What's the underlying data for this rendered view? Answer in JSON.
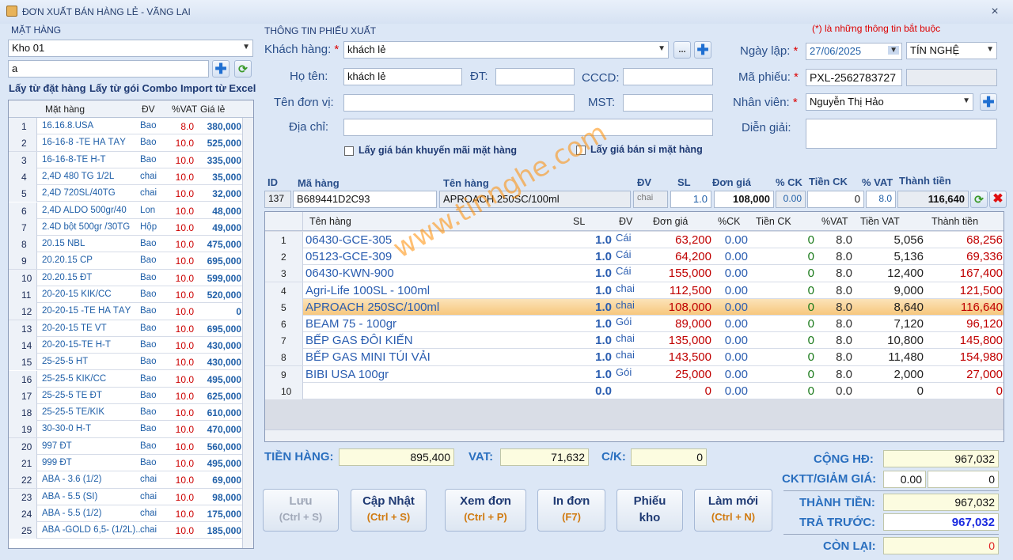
{
  "window": {
    "title": "ĐƠN XUẤT BÁN HÀNG LẺ - VÃNG LAI",
    "close": "×"
  },
  "left": {
    "section_title": "MẶT HÀNG",
    "warehouse": "Kho 01",
    "search_value": "a",
    "links": [
      "Lấy từ đặt hàng",
      "Lấy từ gói Combo",
      "Import từ Excel"
    ],
    "columns": [
      "Mặt hàng",
      "ĐV",
      "%VAT",
      "Giá lẻ"
    ],
    "rows": [
      {
        "no": "1",
        "name": "16.16.8.USA",
        "dv": "Bao",
        "vat": "8.0",
        "gia": "380,000"
      },
      {
        "no": "2",
        "name": "16-16-8 -TE HÀ TÂY",
        "dv": "Bao",
        "vat": "10.0",
        "gia": "525,000"
      },
      {
        "no": "3",
        "name": "16-16-8-TE H-T",
        "dv": "Bao",
        "vat": "10.0",
        "gia": "335,000"
      },
      {
        "no": "4",
        "name": "2,4D  480 TG 1/2L",
        "dv": "chai",
        "vat": "10.0",
        "gia": "35,000"
      },
      {
        "no": "5",
        "name": "2,4D 720SL/40TG",
        "dv": "chai",
        "vat": "10.0",
        "gia": "32,000"
      },
      {
        "no": "6",
        "name": "2,4D ALDO 500gr/40",
        "dv": "Lon",
        "vat": "10.0",
        "gia": "48,000"
      },
      {
        "no": "7",
        "name": "2.4D bột 500gr /30TG",
        "dv": "Hộp",
        "vat": "10.0",
        "gia": "49,000"
      },
      {
        "no": "8",
        "name": "20.15 NBL",
        "dv": "Bao",
        "vat": "10.0",
        "gia": "475,000"
      },
      {
        "no": "9",
        "name": "20.20.15 CP",
        "dv": "Bao",
        "vat": "10.0",
        "gia": "695,000"
      },
      {
        "no": "10",
        "name": "20.20.15 ĐT",
        "dv": "Bao",
        "vat": "10.0",
        "gia": "599,000"
      },
      {
        "no": "11",
        "name": "20-20-15 KIK/CC",
        "dv": "Bao",
        "vat": "10.0",
        "gia": "520,000"
      },
      {
        "no": "12",
        "name": "20-20-15 -TE HÀ TÂY",
        "dv": "Bao",
        "vat": "10.0",
        "gia": "0"
      },
      {
        "no": "13",
        "name": "20-20-15 TE VT",
        "dv": "Bao",
        "vat": "10.0",
        "gia": "695,000"
      },
      {
        "no": "14",
        "name": "20-20-15-TE H-T",
        "dv": "Bao",
        "vat": "10.0",
        "gia": "430,000"
      },
      {
        "no": "15",
        "name": "25-25-5 HT",
        "dv": "Bao",
        "vat": "10.0",
        "gia": "430,000"
      },
      {
        "no": "16",
        "name": "25-25-5 KIK/CC",
        "dv": "Bao",
        "vat": "10.0",
        "gia": "495,000"
      },
      {
        "no": "17",
        "name": "25-25-5 TE ĐT",
        "dv": "Bao",
        "vat": "10.0",
        "gia": "625,000"
      },
      {
        "no": "18",
        "name": "25-25-5 TE/KIK",
        "dv": "Bao",
        "vat": "10.0",
        "gia": "610,000"
      },
      {
        "no": "19",
        "name": "30-30-0 H-T",
        "dv": "Bao",
        "vat": "10.0",
        "gia": "470,000"
      },
      {
        "no": "20",
        "name": "997 ĐT",
        "dv": "Bao",
        "vat": "10.0",
        "gia": "560,000"
      },
      {
        "no": "21",
        "name": "999 ĐT",
        "dv": "Bao",
        "vat": "10.0",
        "gia": "495,000"
      },
      {
        "no": "22",
        "name": "ABA - 3.6 (1/2)",
        "dv": "chai",
        "vat": "10.0",
        "gia": "69,000"
      },
      {
        "no": "23",
        "name": "ABA - 5.5  (SI)",
        "dv": "chai",
        "vat": "10.0",
        "gia": "98,000"
      },
      {
        "no": "24",
        "name": "ABA - 5.5 (1/2)",
        "dv": "chai",
        "vat": "10.0",
        "gia": "175,000"
      },
      {
        "no": "25",
        "name": "ABA -GOLD 6,5- (1/2L)...",
        "dv": "chai",
        "vat": "10.0",
        "gia": "185,000"
      }
    ]
  },
  "form": {
    "section_title": "THÔNG TIN PHIẾU XUẤT",
    "required_note": "(*) là những thông tin bắt buộc",
    "khach_hang_label": "Khách hàng:",
    "khach_hang": "khách lẻ",
    "dots": "...",
    "ho_ten_label": "Họ tên:",
    "ho_ten": "khách lẻ",
    "dt_label": "ĐT:",
    "cccd_label": "CCCD:",
    "ten_don_vi_label": "Tên đơn vị:",
    "mst_label": "MST:",
    "dia_chi_label": "Địa chỉ:",
    "chk_khuyen_mai": "Lấy giá bán khuyến mãi mặt hàng",
    "chk_si": "Lấy giá bán sỉ mặt hàng",
    "ngay_lap_label": "Ngày lập:",
    "ngay_lap": "27/06/2025",
    "tin_nghe": "TÍN NGHỆ",
    "ma_phieu_label": "Mã phiếu:",
    "ma_phieu": "PXL-2562783727",
    "nhan_vien_label": "Nhân viên:",
    "nhan_vien": "Nguyễn Thị Hảo",
    "dien_giai_label": "Diễn giải:",
    "star": "*"
  },
  "entry": {
    "headers": {
      "id": "ID",
      "ma": "Mã hàng",
      "ten": "Tên hàng",
      "dv": "ĐV",
      "sl": "SL",
      "dg": "Đơn giá",
      "ck": "% CK",
      "tck": "Tiền CK",
      "vat": "% VAT",
      "tt": "Thành tiền"
    },
    "id": "137",
    "ma": "B689441D2C93",
    "ten": "APROACH 250SC/100ml",
    "dv": "chai",
    "sl": "1.0",
    "dg": "108,000",
    "ck": "0.00",
    "tck": "0",
    "vat": "8.0",
    "tt": "116,640"
  },
  "grid": {
    "columns": [
      "Tên hàng",
      "SL",
      "ĐV",
      "Đơn giá",
      "%CK",
      "Tiền CK",
      "%VAT",
      "Tiền VAT",
      "Thành tiền"
    ],
    "rows": [
      {
        "no": "1",
        "ten": "06430-GCE-305",
        "sl": "1.0",
        "dv": "Cái",
        "dg": "63,200",
        "ck": "0.00",
        "tck": "0",
        "vat": "8.0",
        "tvat": "5,056",
        "tt": "68,256"
      },
      {
        "no": "2",
        "ten": "05123-GCE-309",
        "sl": "1.0",
        "dv": "Cái",
        "dg": "64,200",
        "ck": "0.00",
        "tck": "0",
        "vat": "8.0",
        "tvat": "5,136",
        "tt": "69,336"
      },
      {
        "no": "3",
        "ten": "06430-KWN-900",
        "sl": "1.0",
        "dv": "Cái",
        "dg": "155,000",
        "ck": "0.00",
        "tck": "0",
        "vat": "8.0",
        "tvat": "12,400",
        "tt": "167,400"
      },
      {
        "no": "4",
        "ten": "Agri-Life 100SL - 100ml",
        "sl": "1.0",
        "dv": "chai",
        "dg": "112,500",
        "ck": "0.00",
        "tck": "0",
        "vat": "8.0",
        "tvat": "9,000",
        "tt": "121,500"
      },
      {
        "no": "5",
        "ten": "APROACH 250SC/100ml",
        "sl": "1.0",
        "dv": "chai",
        "dg": "108,000",
        "ck": "0.00",
        "tck": "0",
        "vat": "8.0",
        "tvat": "8,640",
        "tt": "116,640"
      },
      {
        "no": "6",
        "ten": "BEAM 75 - 100gr",
        "sl": "1.0",
        "dv": "Gói",
        "dg": "89,000",
        "ck": "0.00",
        "tck": "0",
        "vat": "8.0",
        "tvat": "7,120",
        "tt": "96,120"
      },
      {
        "no": "7",
        "ten": "BẾP GAS ĐÔI KIẾN",
        "sl": "1.0",
        "dv": "chai",
        "dg": "135,000",
        "ck": "0.00",
        "tck": "0",
        "vat": "8.0",
        "tvat": "10,800",
        "tt": "145,800"
      },
      {
        "no": "8",
        "ten": "BẾP GAS MINI TÚI VẢI",
        "sl": "1.0",
        "dv": "chai",
        "dg": "143,500",
        "ck": "0.00",
        "tck": "0",
        "vat": "8.0",
        "tvat": "11,480",
        "tt": "154,980"
      },
      {
        "no": "9",
        "ten": "BIBI USA 100gr",
        "sl": "1.0",
        "dv": "Gói",
        "dg": "25,000",
        "ck": "0.00",
        "tck": "0",
        "vat": "8.0",
        "tvat": "2,000",
        "tt": "27,000"
      },
      {
        "no": "10",
        "ten": "",
        "sl": "0.0",
        "dv": "",
        "dg": "0",
        "ck": "0.00",
        "tck": "0",
        "vat": "0.0",
        "tvat": "0",
        "tt": "0"
      }
    ]
  },
  "watermark": "www.tinnghe.com",
  "totals": {
    "tien_hang_label": "TIỀN HÀNG:",
    "tien_hang": "895,400",
    "vat_label": "VAT:",
    "vat": "71,632",
    "ck_label": "C/K:",
    "ck": "0",
    "cong_hd_label": "CỘNG HĐ:",
    "cong_hd": "967,032",
    "cktt_label": "CKTT/GIẢM GIÁ:",
    "cktt_pct": "0.00",
    "cktt": "0",
    "thanh_tien_label": "THÀNH TIỀN:",
    "thanh_tien": "967,032",
    "tra_truoc_label": "TRẢ TRƯỚC:",
    "tra_truoc": "967,032",
    "con_lai_label": "CÒN LẠI:",
    "con_lai": "0"
  },
  "buttons": [
    {
      "label": "Lưu",
      "shortcut": "(Ctrl + S)"
    },
    {
      "label": "Cập Nhật",
      "shortcut": "(Ctrl + S)"
    },
    {
      "label": "Xem đơn",
      "shortcut": "(Ctrl + P)"
    },
    {
      "label": "In đơn",
      "shortcut": "(F7)"
    },
    {
      "label": "Phiếu",
      "shortcut": "kho"
    },
    {
      "label": "Làm mới",
      "shortcut": "(Ctrl + N)"
    }
  ]
}
